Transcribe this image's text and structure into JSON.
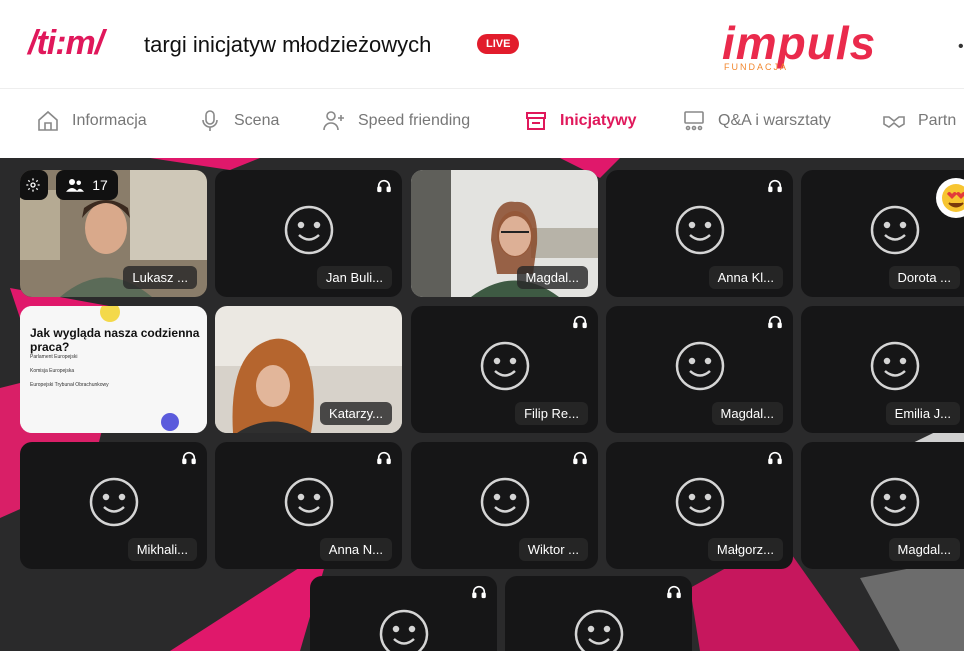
{
  "header": {
    "logo": "/ti:m/",
    "title": "targi inicjatyw młodzieżowych",
    "live_badge": "LIVE",
    "brand": "impuls",
    "brand_sub": "FUNDACJA"
  },
  "nav": {
    "items": [
      {
        "label": "Informacja",
        "icon": "home-icon"
      },
      {
        "label": "Scena",
        "icon": "microphone-icon"
      },
      {
        "label": "Speed friending",
        "icon": "add-person-icon"
      },
      {
        "label": "Inicjatywy",
        "icon": "booth-icon",
        "active": true
      },
      {
        "label": "Q&A i warsztaty",
        "icon": "workshop-icon"
      },
      {
        "label": "Partn",
        "icon": "handshake-icon"
      }
    ]
  },
  "controls": {
    "participants_count": "17"
  },
  "participants": [
    {
      "name": "Lukasz ..."
    },
    {
      "name": "Jan Buli..."
    },
    {
      "name": "Magdal..."
    },
    {
      "name": "Anna Kl..."
    },
    {
      "name": "Dorota ..."
    },
    {
      "name": "Katarzy..."
    },
    {
      "name": "Filip Re..."
    },
    {
      "name": "Magdal..."
    },
    {
      "name": "Emilia J..."
    },
    {
      "name": "Mikhali..."
    },
    {
      "name": "Anna N..."
    },
    {
      "name": "Wiktor ..."
    },
    {
      "name": "Małgorz..."
    },
    {
      "name": "Magdal..."
    }
  ],
  "shared_slide": {
    "title": "Jak wygląda nasza codzienna praca?",
    "lines": [
      "Parlament Europejski",
      "Komisja Europejska",
      "Europejski Trybunał Obrachunkowy"
    ]
  },
  "colors": {
    "accent": "#e0185b",
    "live": "#e21c2c",
    "stage_bg": "#2a2a2b",
    "brand": "#ea2a4c"
  }
}
